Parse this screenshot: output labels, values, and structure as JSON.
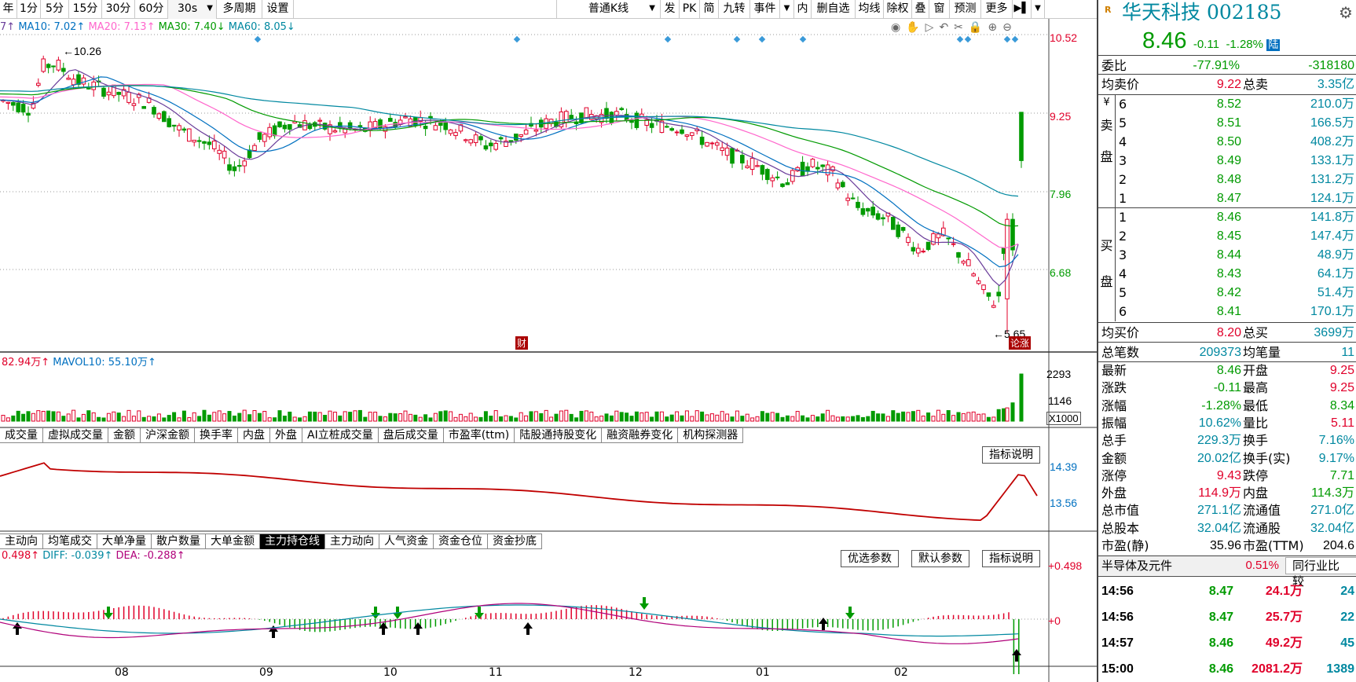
{
  "toolbar": {
    "left": [
      "年",
      "1分",
      "5分",
      "15分",
      "30分",
      "60分",
      "30s",
      "多周期",
      "设置"
    ],
    "kline_type": "普通K线",
    "right": [
      "发",
      "PK",
      "简",
      "九转",
      "事件",
      "内",
      "删自选",
      "均线",
      "除权",
      "叠",
      "窗",
      "预测",
      "更多"
    ]
  },
  "ma_legend": {
    "prefix": "7↑",
    "ma10": "MA10: 7.02↑",
    "ma20": "MA20: 7.13↑",
    "ma30": "MA30: 7.40↓",
    "ma60": "MA60: 8.05↓"
  },
  "price_axis": [
    "10.52",
    "9.25",
    "7.96",
    "6.68"
  ],
  "annotations": {
    "high": "10.26",
    "low": "5.65",
    "cai": "财",
    "tag": "论涨"
  },
  "volume": {
    "legend_vol": "82.94万↑",
    "legend_mavol": "MAVOL10: 55.10万↑",
    "axis": [
      "2293",
      "1146"
    ],
    "unit": "X1000"
  },
  "indicator_tabs_1": [
    "成交量",
    "虚拟成交量",
    "金额",
    "沪深金额",
    "换手率",
    "内盘",
    "外盘",
    "AI立桩成交量",
    "盘后成交量",
    "市盈率(ttm)",
    "陆股通持股变化",
    "融资融券变化",
    "机构探测器"
  ],
  "indicator_tabs_1_dots": [
    false,
    false,
    false,
    true,
    false,
    false,
    false,
    false,
    false,
    true,
    true,
    true,
    true
  ],
  "panel2": {
    "explain": "指标说明",
    "axis": [
      "14.39",
      "13.56"
    ]
  },
  "indicator_tabs_2": [
    "主动向",
    "均笔成交",
    "大单净量",
    "散户数量",
    "大单金额",
    "主力持仓线",
    "主力动向",
    "人气资金",
    "资金仓位",
    "资金抄底"
  ],
  "indicator_tabs_2_active": 5,
  "macd": {
    "legend_macd": "0.498↑",
    "legend_diff": "DIFF: -0.039↑",
    "legend_dea": "DEA: -0.288↑",
    "axis_top": "+0.498",
    "axis_zero": "+0",
    "btn_opt": "优选参数",
    "btn_default": "默认参数",
    "btn_explain": "指标说明"
  },
  "x_axis": [
    "08",
    "09",
    "10",
    "11",
    "12",
    "01",
    "02"
  ],
  "colors": {
    "up": "#e0002a",
    "down": "#009a00",
    "ma10": "#0070c0",
    "ma20": "#ff66cc",
    "ma30": "#009a00",
    "ma60": "#0088a0",
    "ma5": "#6a3d9a"
  },
  "quote": {
    "logo": "R",
    "name": "华天科技 002185",
    "price": "8.46",
    "change": "-0.11",
    "pct": "-1.28%",
    "market_tag": "陆",
    "weibi_label": "委比",
    "weibi": "-77.91%",
    "weicha": "-318180",
    "avg_sell_label": "均卖价",
    "avg_sell": "9.22",
    "total_sell_label": "总卖",
    "total_sell": "3.35亿",
    "sell_side_label": [
      "¥",
      "卖",
      "盘"
    ],
    "buy_side_label": [
      "买",
      "盘"
    ],
    "asks": [
      {
        "lvl": "6",
        "price": "8.52",
        "vol": "210.0万"
      },
      {
        "lvl": "5",
        "price": "8.51",
        "vol": "166.5万"
      },
      {
        "lvl": "4",
        "price": "8.50",
        "vol": "408.2万"
      },
      {
        "lvl": "3",
        "price": "8.49",
        "vol": "133.1万"
      },
      {
        "lvl": "2",
        "price": "8.48",
        "vol": "131.2万"
      },
      {
        "lvl": "1",
        "price": "8.47",
        "vol": "124.1万"
      }
    ],
    "bids": [
      {
        "lvl": "1",
        "price": "8.46",
        "vol": "141.8万"
      },
      {
        "lvl": "2",
        "price": "8.45",
        "vol": "147.4万"
      },
      {
        "lvl": "3",
        "price": "8.44",
        "vol": "48.9万"
      },
      {
        "lvl": "4",
        "price": "8.43",
        "vol": "64.1万"
      },
      {
        "lvl": "5",
        "price": "8.42",
        "vol": "51.4万"
      },
      {
        "lvl": "6",
        "price": "8.41",
        "vol": "170.1万"
      }
    ],
    "avg_buy_label": "均买价",
    "avg_buy": "8.20",
    "total_buy_label": "总买",
    "total_buy": "3699万",
    "trades_label": "总笔数",
    "trades": "209373",
    "avg_lot_label": "均笔量",
    "avg_lot": "11",
    "stats": [
      {
        "l1": "最新",
        "v1": "8.46",
        "c1": "green",
        "l2": "开盘",
        "v2": "9.25",
        "c2": "red"
      },
      {
        "l1": "涨跌",
        "v1": "-0.11",
        "c1": "green",
        "l2": "最高",
        "v2": "9.25",
        "c2": "red"
      },
      {
        "l1": "涨幅",
        "v1": "-1.28%",
        "c1": "green",
        "l2": "最低",
        "v2": "8.34",
        "c2": "green"
      },
      {
        "l1": "振幅",
        "v1": "10.62%",
        "c1": "teal",
        "l2": "量比",
        "v2": "5.11",
        "c2": "red"
      },
      {
        "l1": "总手",
        "v1": "229.3万",
        "c1": "teal",
        "l2": "换手",
        "v2": "7.16%",
        "c2": "teal"
      },
      {
        "l1": "金额",
        "v1": "20.02亿",
        "c1": "teal",
        "l2": "换手(实)",
        "v2": "9.17%",
        "c2": "teal"
      },
      {
        "l1": "涨停",
        "v1": "9.43",
        "c1": "red",
        "l2": "跌停",
        "v2": "7.71",
        "c2": "green"
      },
      {
        "l1": "外盘",
        "v1": "114.9万",
        "c1": "red",
        "l2": "内盘",
        "v2": "114.3万",
        "c2": "green"
      },
      {
        "l1": "总市值",
        "v1": "271.1亿",
        "c1": "teal",
        "l2": "流通值",
        "v2": "271.0亿",
        "c2": "teal"
      },
      {
        "l1": "总股本",
        "v1": "32.04亿",
        "c1": "teal",
        "l2": "流通股",
        "v2": "32.04亿",
        "c2": "teal"
      },
      {
        "l1": "市盈(静)",
        "v1": "35.96",
        "c1": "black",
        "l2": "市盈(TTM)",
        "v2": "204.6",
        "c2": "black"
      }
    ],
    "industry": "半导体及元件",
    "industry_pct": "0.51%",
    "compare": "同行业比较",
    "ticks": [
      {
        "time": "14:56",
        "price": "8.47",
        "amount": "24.1万",
        "n": "24"
      },
      {
        "time": "14:56",
        "price": "8.47",
        "amount": "25.7万",
        "n": "22"
      },
      {
        "time": "14:57",
        "price": "8.46",
        "amount": "49.2万",
        "n": "45"
      },
      {
        "time": "15:00",
        "price": "8.46",
        "amount": "2081.2万",
        "n": "1389"
      }
    ]
  }
}
